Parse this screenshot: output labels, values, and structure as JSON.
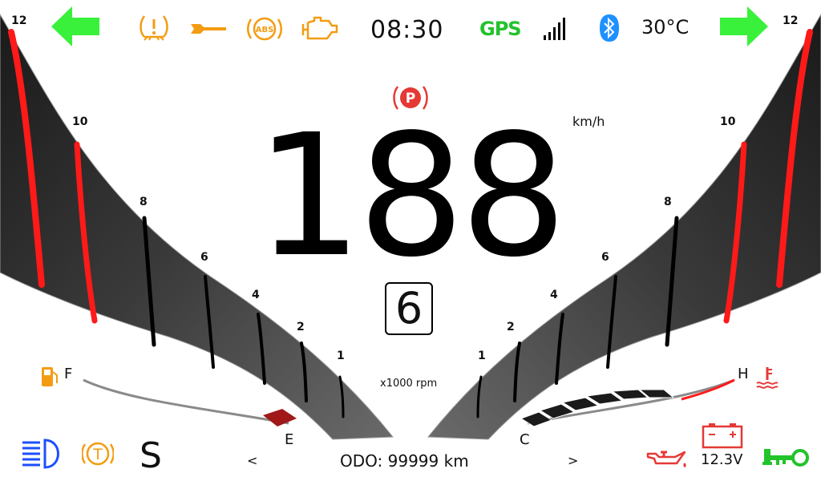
{
  "status_bar": {
    "clock": "08:30",
    "gps_label": "GPS",
    "temperature": "30°C",
    "left_turn_signal": "turn-left-arrow-icon",
    "right_turn_signal": "turn-right-arrow-icon",
    "warning_icons": [
      "tire-pressure-icon",
      "wrench-icon",
      "abs-icon",
      "engine-icon"
    ],
    "signal_bars": 5,
    "bluetooth": "bluetooth-icon"
  },
  "speedometer": {
    "speed": "188",
    "unit": "km/h",
    "parking_brake": "parking-brake-icon"
  },
  "gear": {
    "current": "6"
  },
  "tachometer": {
    "label": "x1000 rpm",
    "left_ticks": [
      "12",
      "10",
      "8",
      "6",
      "4",
      "2",
      "1"
    ],
    "right_ticks": [
      "12",
      "10",
      "8",
      "6",
      "4",
      "2",
      "1"
    ]
  },
  "fuel_gauge": {
    "full_label": "F",
    "empty_label": "E",
    "level": 0.05
  },
  "temp_gauge": {
    "hot_label": "H",
    "cold_label": "C",
    "level": 0.85
  },
  "bottom_bar": {
    "mode": "S",
    "odometer": "ODO: 99999 km",
    "prev_label": "<",
    "next_label": ">",
    "battery_voltage": "12.3V"
  },
  "colors": {
    "turn_signal": "#39f13a",
    "warning": "#f39c12",
    "gps": "#22c32b",
    "bluetooth": "#1e90ff",
    "redline": "#ff0000",
    "headlight": "#1e4fff",
    "key": "#22c32b"
  }
}
